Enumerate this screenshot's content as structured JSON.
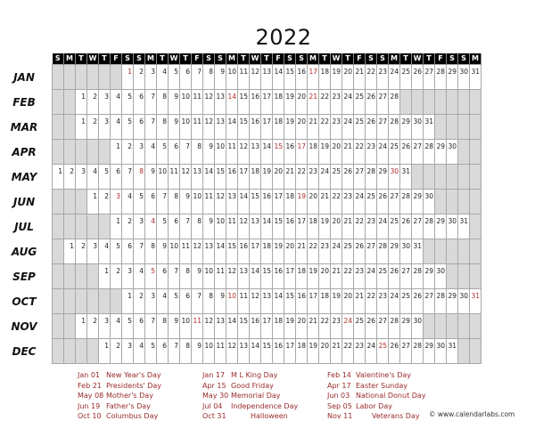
{
  "title": "2022",
  "weekday_header": [
    "S",
    "M",
    "T",
    "W",
    "T",
    "F",
    "S",
    "S",
    "M",
    "T",
    "W",
    "T",
    "F",
    "S",
    "S",
    "M",
    "T",
    "W",
    "T",
    "F",
    "S",
    "S",
    "M",
    "T",
    "W",
    "T",
    "F",
    "S",
    "S",
    "M",
    "T",
    "W",
    "T",
    "F",
    "S",
    "S",
    "M"
  ],
  "months": [
    {
      "label": "JAN",
      "offset": 6,
      "days": 31,
      "holidays": [
        1,
        17
      ]
    },
    {
      "label": "FEB",
      "offset": 2,
      "days": 28,
      "holidays": [
        14,
        21
      ]
    },
    {
      "label": "MAR",
      "offset": 2,
      "days": 31,
      "holidays": []
    },
    {
      "label": "APR",
      "offset": 5,
      "days": 30,
      "holidays": [
        15,
        17
      ]
    },
    {
      "label": "MAY",
      "offset": 0,
      "days": 31,
      "holidays": [
        8,
        30
      ]
    },
    {
      "label": "JUN",
      "offset": 3,
      "days": 30,
      "holidays": [
        3,
        19
      ]
    },
    {
      "label": "JUL",
      "offset": 5,
      "days": 31,
      "holidays": [
        4
      ]
    },
    {
      "label": "AUG",
      "offset": 1,
      "days": 31,
      "holidays": []
    },
    {
      "label": "SEP",
      "offset": 4,
      "days": 30,
      "holidays": [
        5
      ]
    },
    {
      "label": "OCT",
      "offset": 6,
      "days": 31,
      "holidays": [
        10,
        31
      ]
    },
    {
      "label": "NOV",
      "offset": 2,
      "days": 30,
      "holidays": [
        11,
        24
      ]
    },
    {
      "label": "DEC",
      "offset": 4,
      "days": 31,
      "holidays": [
        25
      ]
    }
  ],
  "holiday_columns": [
    [
      {
        "date": "Jan 01",
        "name": "New Year's Day"
      },
      {
        "date": "Feb 21",
        "name": "Presidents' Day"
      },
      {
        "date": "May 08",
        "name": "Mother's Day"
      },
      {
        "date": "Jun 19",
        "name": "Father's Day"
      },
      {
        "date": "Oct 10",
        "name": "Columbus Day"
      }
    ],
    [
      {
        "date": "Jan 17",
        "name": "M L King Day"
      },
      {
        "date": "Apr 15",
        "name": "Good Friday"
      },
      {
        "date": "May 30",
        "name": "Memorial Day"
      },
      {
        "date": "Jul 04",
        "name": "Independence Day"
      },
      {
        "date": "Oct 31",
        "name": "Halloween"
      }
    ],
    [
      {
        "date": "Feb 14",
        "name": "Valentine's Day"
      },
      {
        "date": "Apr 17",
        "name": "Easter Sunday"
      },
      {
        "date": "Jun 03",
        "name": "National Donut Day"
      },
      {
        "date": "Sep 05",
        "name": "Labor Day"
      },
      {
        "date": "Nov 11",
        "name": "Veterans Day"
      }
    ]
  ],
  "copyright": "© www.calendarlabs.com",
  "colors": {
    "holiday": "#b52a2a",
    "empty_cell": "#d9d9d9",
    "header_bg": "#000000"
  }
}
